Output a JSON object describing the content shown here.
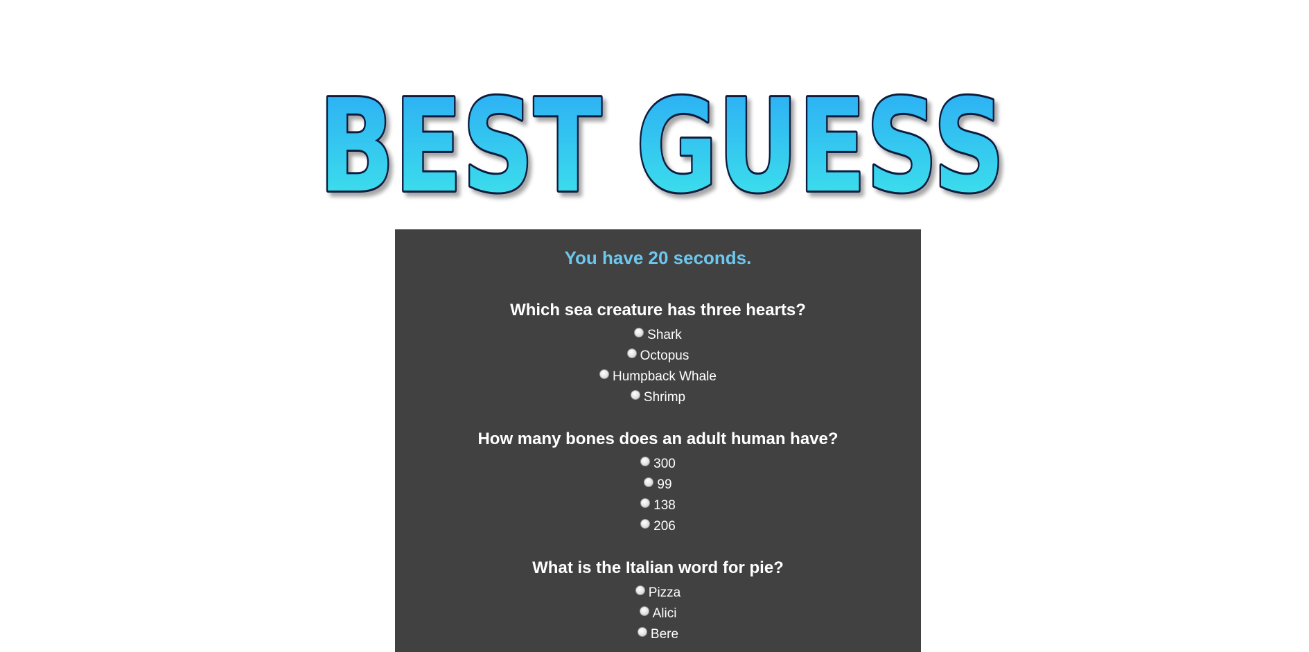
{
  "logo": {
    "text": "BEST GUESS"
  },
  "timer": {
    "text": "You have 20 seconds."
  },
  "questions": [
    {
      "text": "Which sea creature has three hearts?",
      "options": [
        "Shark",
        "Octopus",
        "Humpback Whale",
        "Shrimp"
      ]
    },
    {
      "text": "How many bones does an adult human have?",
      "options": [
        "300",
        "99",
        "138",
        "206"
      ]
    },
    {
      "text": "What is the Italian word for pie?",
      "options": [
        "Pizza",
        "Alici",
        "Bere"
      ]
    }
  ],
  "colors": {
    "panel_background": "#414141",
    "timer_text": "#6ec7ef",
    "logo_fill_top": "#2aa8f5",
    "logo_fill_bottom": "#3fe8ea",
    "logo_outline": "#101a3e"
  }
}
